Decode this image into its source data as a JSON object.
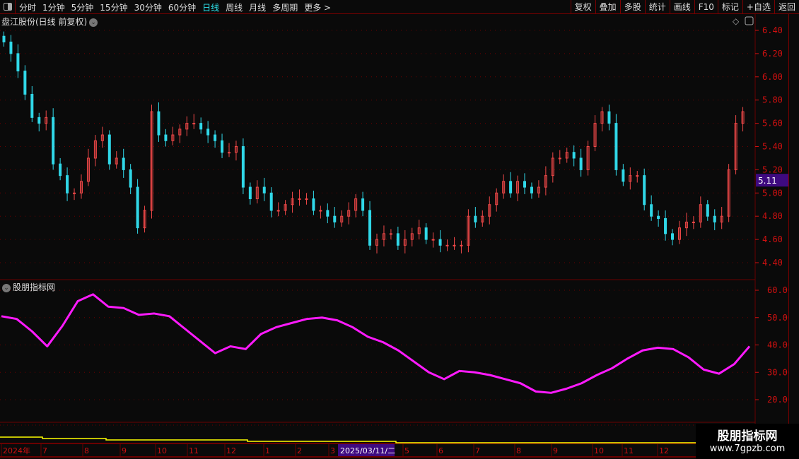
{
  "toolbar": {
    "periods": [
      "分时",
      "1分钟",
      "5分钟",
      "15分钟",
      "30分钟",
      "60分钟",
      "日线",
      "周线",
      "月线",
      "多周期",
      "更多 >"
    ],
    "active_period": "日线",
    "tools": [
      "复权",
      "叠加",
      "多股",
      "统计",
      "画线",
      "F10",
      "标记",
      "+自选",
      "返回"
    ]
  },
  "chart_title": "盘江股份(日线 前复权)",
  "indicator_title": "股朋指标网",
  "colors": {
    "up": "#f04848",
    "down": "#30d8e8",
    "indicator": "#ff1aff",
    "axis": "#d01010",
    "grid": "#6a0000",
    "price_tag": "#3e0a80",
    "volume_line": "#ffff00"
  },
  "price_axis": {
    "ticks": [
      "6.40",
      "6.20",
      "6.00",
      "5.80",
      "5.60",
      "5.40",
      "5.20",
      "5.00",
      "4.80",
      "4.60",
      "4.40"
    ],
    "range": [
      4.4,
      6.4
    ]
  },
  "current_price": "5.11",
  "indicator_axis": {
    "ticks": [
      "60.00",
      "50.00",
      "40.00",
      "30.00",
      "20.00"
    ],
    "range": [
      20,
      60
    ]
  },
  "date_axis": [
    "2024年",
    "7",
    "8",
    "9",
    "10",
    "11",
    "12",
    "1",
    "2",
    "3",
    "5",
    "6",
    "7",
    "8",
    "9",
    "10",
    "11",
    "12"
  ],
  "cursor_date": "2025/03/11/二",
  "chart_data": {
    "type": "candlestick",
    "closes": [
      6.3,
      6.2,
      6.05,
      5.85,
      5.65,
      5.6,
      5.65,
      5.25,
      5.15,
      5.0,
      5.0,
      5.1,
      5.3,
      5.45,
      5.5,
      5.25,
      5.3,
      5.2,
      5.05,
      4.7,
      4.85,
      5.7,
      5.5,
      5.45,
      5.5,
      5.55,
      5.6,
      5.6,
      5.55,
      5.5,
      5.45,
      5.35,
      5.35,
      5.4,
      5.05,
      4.95,
      5.05,
      5.0,
      4.85,
      4.85,
      4.9,
      4.95,
      4.95,
      4.95,
      4.85,
      4.85,
      4.8,
      4.75,
      4.8,
      4.85,
      4.95,
      4.85,
      4.55,
      4.6,
      4.65,
      4.65,
      4.55,
      4.6,
      4.65,
      4.7,
      4.6,
      4.6,
      4.55,
      4.55,
      4.55,
      4.55,
      4.8,
      4.75,
      4.8,
      4.9,
      5.0,
      5.1,
      5.0,
      5.1,
      5.05,
      5.0,
      5.05,
      5.15,
      5.3,
      5.3,
      5.35,
      5.3,
      5.2,
      5.4,
      5.6,
      5.7,
      5.6,
      5.2,
      5.1,
      5.15,
      5.15,
      4.9,
      4.8,
      4.78,
      4.65,
      4.6,
      4.7,
      4.75,
      4.75,
      4.9,
      4.8,
      4.75,
      4.8,
      5.2,
      5.6,
      5.7
    ],
    "indicator": [
      50.5,
      49.5,
      45,
      39.5,
      47,
      56,
      58.5,
      54,
      53.5,
      51,
      51.5,
      50.5,
      46,
      41.5,
      37,
      39.5,
      38.5,
      44,
      46.5,
      48,
      49.5,
      50,
      49,
      46.5,
      43,
      41,
      38,
      34,
      30,
      27.5,
      30.5,
      30,
      29,
      27.5,
      26,
      23,
      22.5,
      24,
      26,
      29,
      31.5,
      35,
      38,
      39,
      38.5,
      35.5,
      31,
      29.5,
      33,
      39.5
    ],
    "indicator_ylim": [
      20,
      60
    ],
    "ylim": [
      4.4,
      6.4
    ]
  },
  "watermark": {
    "name": "股朋指标网",
    "url": "www.7gpzb.com"
  }
}
